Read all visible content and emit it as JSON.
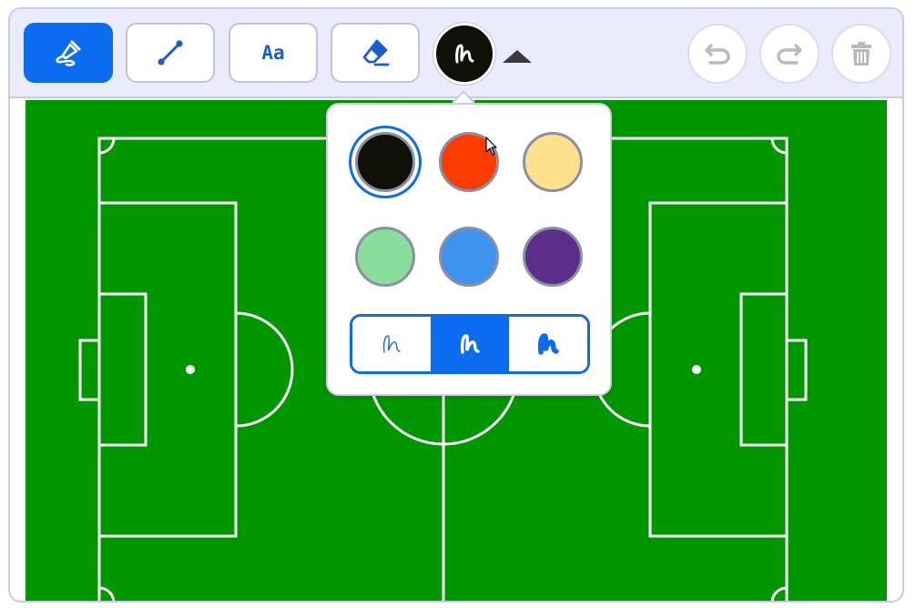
{
  "toolbar": {
    "tools": [
      {
        "id": "draw",
        "icon": "freehand-pen-icon",
        "active": true
      },
      {
        "id": "line",
        "icon": "line-tool-icon",
        "active": false
      },
      {
        "id": "text",
        "icon": "text-tool-icon",
        "label": "Aa",
        "active": false
      },
      {
        "id": "eraser",
        "icon": "eraser-icon",
        "active": false
      }
    ],
    "current_color": "#111008",
    "actions": [
      {
        "id": "undo",
        "icon": "undo-icon"
      },
      {
        "id": "redo",
        "icon": "redo-icon"
      },
      {
        "id": "clear",
        "icon": "trash-icon"
      }
    ]
  },
  "color_popup": {
    "colors": [
      "#111008",
      "#fa3c00",
      "#ffe08c",
      "#88de9a",
      "#3d93ee",
      "#5c2e8a"
    ],
    "selected_color_index": 0,
    "stroke_widths": [
      "thin",
      "medium",
      "thick"
    ],
    "selected_width_index": 1
  },
  "canvas": {
    "background": "soccer-field",
    "grass_color": "#009600",
    "line_color": "#ffffff"
  }
}
